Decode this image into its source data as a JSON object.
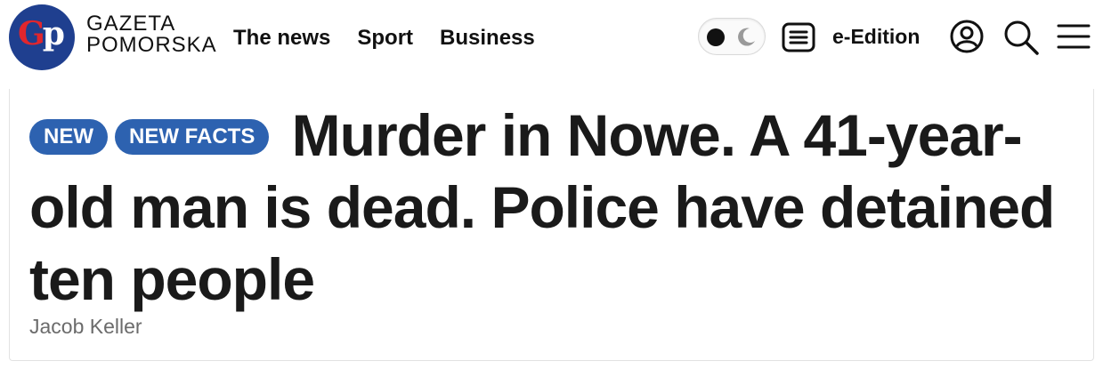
{
  "brand": {
    "logo_letters": [
      "G",
      "p"
    ],
    "name_line1": "GAZETA",
    "name_line2": "POMORSKA",
    "colors": {
      "logo_bg": "#1f3f8f",
      "logo_g": "#e1262d",
      "logo_p": "#ffffff"
    }
  },
  "nav": {
    "items": [
      {
        "label": "The news"
      },
      {
        "label": "Sport"
      },
      {
        "label": "Business"
      }
    ]
  },
  "toolbar": {
    "theme_toggle_icons": [
      "dot-icon",
      "moon-icon"
    ],
    "e_edition_label": "e-Edition",
    "icons": [
      "document-list-icon",
      "user-icon",
      "search-icon",
      "hamburger-menu-icon"
    ]
  },
  "article": {
    "badges": [
      "NEW",
      "NEW FACTS"
    ],
    "badge_color": "#2d62b0",
    "title": "Murder in Nowe. A 41-year-old man is dead. Police have detained ten people",
    "author": "Jacob Keller"
  }
}
